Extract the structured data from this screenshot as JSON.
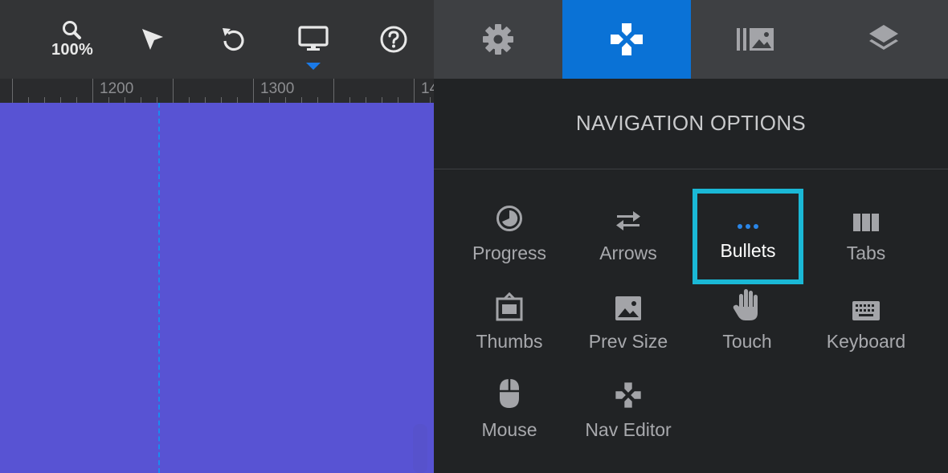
{
  "toolbar": {
    "zoom_label": "100%",
    "icons": [
      "zoom-icon",
      "select-arrow-icon",
      "undo-icon",
      "desktop-icon",
      "help-icon"
    ]
  },
  "panel_tabs": [
    {
      "name": "settings",
      "icon": "gear-icon",
      "active": false
    },
    {
      "name": "navigation",
      "icon": "gamepad-icon",
      "active": true
    },
    {
      "name": "slides",
      "icon": "slides-icon",
      "active": false
    },
    {
      "name": "layers",
      "icon": "layers-icon",
      "active": false
    }
  ],
  "ruler": {
    "labels": [
      "1200",
      "1300",
      "14"
    ]
  },
  "panel": {
    "title": "NAVIGATION OPTIONS",
    "options": [
      {
        "label": "Progress",
        "icon": "progress-icon"
      },
      {
        "label": "Arrows",
        "icon": "arrows-icon"
      },
      {
        "label": "Bullets",
        "icon": "bullets-icon",
        "selected": true
      },
      {
        "label": "Tabs",
        "icon": "tabs-icon"
      },
      {
        "label": "Thumbs",
        "icon": "thumbs-icon"
      },
      {
        "label": "Prev Size",
        "icon": "image-icon"
      },
      {
        "label": "Touch",
        "icon": "hand-icon"
      },
      {
        "label": "Keyboard",
        "icon": "keyboard-icon"
      },
      {
        "label": "Mouse",
        "icon": "mouse-icon"
      },
      {
        "label": "Nav Editor",
        "icon": "gamepad-icon"
      }
    ]
  },
  "colors": {
    "accent": "#0a72d6",
    "selection_outline": "#1ab8d6",
    "canvas": "#5853d3",
    "guide": "#1a8cf0"
  }
}
